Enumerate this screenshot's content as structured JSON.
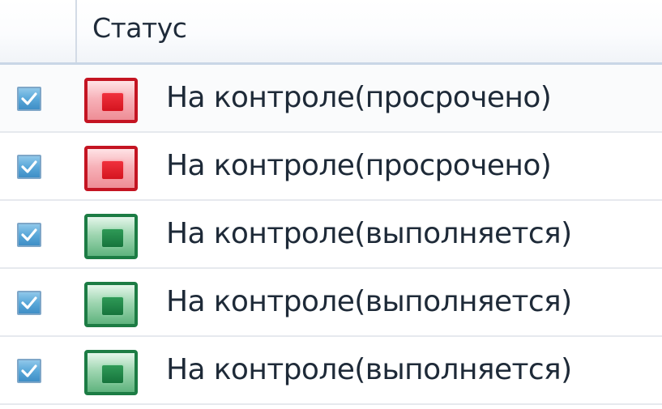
{
  "header": {
    "column_label": "Статус"
  },
  "rows": [
    {
      "checked": true,
      "status_color": "red",
      "label": "На контроле(просрочено)"
    },
    {
      "checked": true,
      "status_color": "red",
      "label": "На контроле(просрочено)"
    },
    {
      "checked": true,
      "status_color": "green",
      "label": "На контроле(выполняется)"
    },
    {
      "checked": true,
      "status_color": "green",
      "label": "На контроле(выполняется)"
    },
    {
      "checked": true,
      "status_color": "green",
      "label": "На контроле(выполняется)"
    }
  ],
  "colors": {
    "red": "#d4141f",
    "green": "#16743c",
    "checkbox": "#5aa8d9"
  },
  "icons": {
    "checkbox": "checkbox-checked-icon",
    "red": "status-overdue-icon",
    "green": "status-in-progress-icon"
  }
}
